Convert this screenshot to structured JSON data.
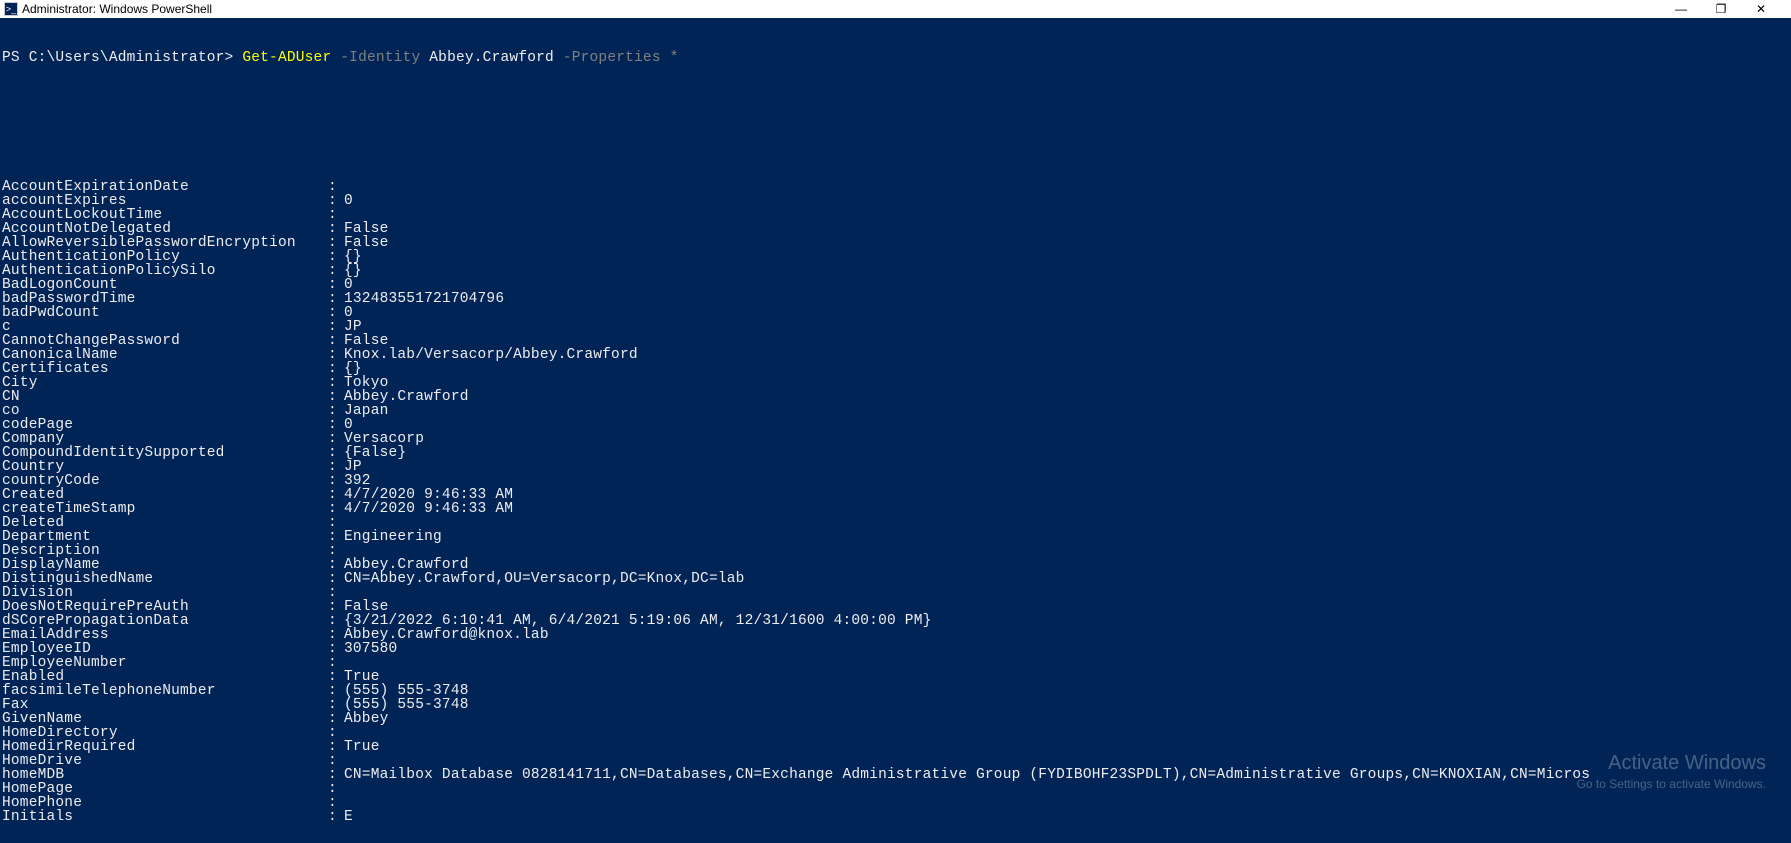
{
  "window": {
    "title": "Administrator: Windows PowerShell"
  },
  "prompt": {
    "path": "PS C:\\Users\\Administrator> ",
    "cmd": "Get-ADUser",
    "arg1": " -Identity",
    "arg2": " Abbey.Crawford",
    "arg3": " -Properties",
    "arg4": " *"
  },
  "props": [
    {
      "k": "AccountExpirationDate",
      "v": ""
    },
    {
      "k": "accountExpires",
      "v": "0"
    },
    {
      "k": "AccountLockoutTime",
      "v": ""
    },
    {
      "k": "AccountNotDelegated",
      "v": "False"
    },
    {
      "k": "AllowReversiblePasswordEncryption",
      "v": "False"
    },
    {
      "k": "AuthenticationPolicy",
      "v": "{}"
    },
    {
      "k": "AuthenticationPolicySilo",
      "v": "{}"
    },
    {
      "k": "BadLogonCount",
      "v": "0"
    },
    {
      "k": "badPasswordTime",
      "v": "132483551721704796"
    },
    {
      "k": "badPwdCount",
      "v": "0"
    },
    {
      "k": "c",
      "v": "JP"
    },
    {
      "k": "CannotChangePassword",
      "v": "False"
    },
    {
      "k": "CanonicalName",
      "v": "Knox.lab/Versacorp/Abbey.Crawford"
    },
    {
      "k": "Certificates",
      "v": "{}"
    },
    {
      "k": "City",
      "v": "Tokyo"
    },
    {
      "k": "CN",
      "v": "Abbey.Crawford"
    },
    {
      "k": "co",
      "v": "Japan"
    },
    {
      "k": "codePage",
      "v": "0"
    },
    {
      "k": "Company",
      "v": "Versacorp"
    },
    {
      "k": "CompoundIdentitySupported",
      "v": "{False}"
    },
    {
      "k": "Country",
      "v": "JP"
    },
    {
      "k": "countryCode",
      "v": "392"
    },
    {
      "k": "Created",
      "v": "4/7/2020 9:46:33 AM"
    },
    {
      "k": "createTimeStamp",
      "v": "4/7/2020 9:46:33 AM"
    },
    {
      "k": "Deleted",
      "v": ""
    },
    {
      "k": "Department",
      "v": "Engineering"
    },
    {
      "k": "Description",
      "v": ""
    },
    {
      "k": "DisplayName",
      "v": "Abbey.Crawford"
    },
    {
      "k": "DistinguishedName",
      "v": "CN=Abbey.Crawford,OU=Versacorp,DC=Knox,DC=lab"
    },
    {
      "k": "Division",
      "v": ""
    },
    {
      "k": "DoesNotRequirePreAuth",
      "v": "False"
    },
    {
      "k": "dSCorePropagationData",
      "v": "{3/21/2022 6:10:41 AM, 6/4/2021 5:19:06 AM, 12/31/1600 4:00:00 PM}"
    },
    {
      "k": "EmailAddress",
      "v": "Abbey.Crawford@knox.lab"
    },
    {
      "k": "EmployeeID",
      "v": "307580"
    },
    {
      "k": "EmployeeNumber",
      "v": ""
    },
    {
      "k": "Enabled",
      "v": "True"
    },
    {
      "k": "facsimileTelephoneNumber",
      "v": "(555) 555-3748"
    },
    {
      "k": "Fax",
      "v": "(555) 555-3748"
    },
    {
      "k": "GivenName",
      "v": "Abbey"
    },
    {
      "k": "HomeDirectory",
      "v": ""
    },
    {
      "k": "HomedirRequired",
      "v": "True"
    },
    {
      "k": "HomeDrive",
      "v": ""
    },
    {
      "k": "homeMDB",
      "v": "CN=Mailbox Database 0828141711,CN=Databases,CN=Exchange Administrative Group (FYDIBOHF23SPDLT),CN=Administrative Groups,CN=KNOXIAN,CN=Micros"
    },
    {
      "k": "HomePage",
      "v": ""
    },
    {
      "k": "HomePhone",
      "v": ""
    },
    {
      "k": "Initials",
      "v": "E"
    }
  ],
  "watermark": {
    "line1": "Activate Windows",
    "line2": "Go to Settings to activate Windows."
  }
}
